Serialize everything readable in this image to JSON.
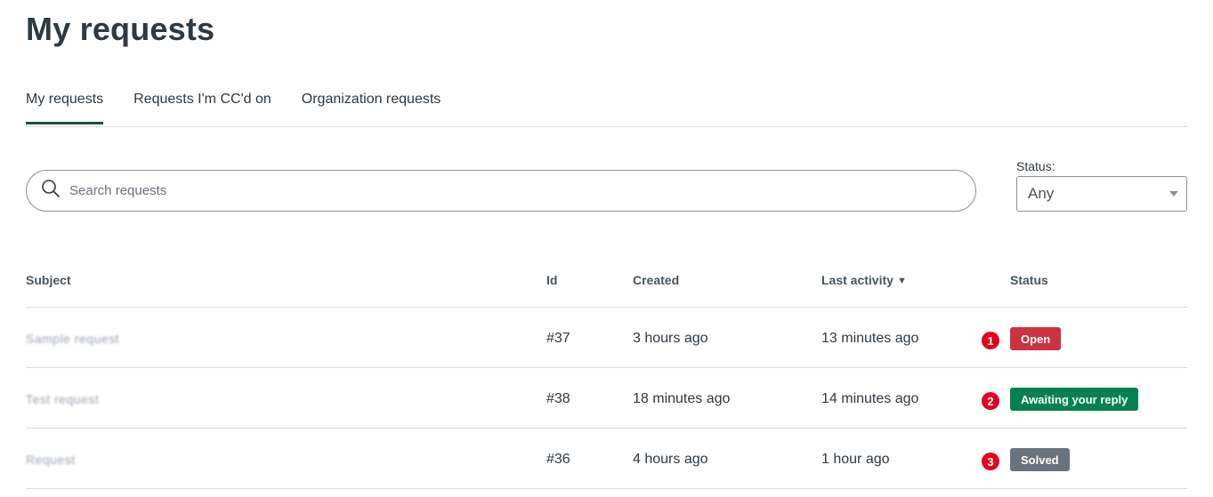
{
  "page": {
    "title": "My requests"
  },
  "tabs": [
    {
      "label": "My requests",
      "active": true
    },
    {
      "label": "Requests I'm CC'd on",
      "active": false
    },
    {
      "label": "Organization requests",
      "active": false
    }
  ],
  "search": {
    "placeholder": "Search requests",
    "value": ""
  },
  "status_filter": {
    "label": "Status:",
    "selected": "Any"
  },
  "table": {
    "headers": {
      "subject": "Subject",
      "id": "Id",
      "created": "Created",
      "last_activity": "Last activity",
      "sort_indicator": "▼",
      "status": "Status"
    },
    "rows": [
      {
        "subject": "Sample request",
        "id": "#37",
        "created": "3 hours ago",
        "last_activity": "13 minutes ago",
        "marker": "1",
        "status": "Open",
        "status_color": "#cc3340"
      },
      {
        "subject": "Test request",
        "id": "#38",
        "created": "18 minutes ago",
        "last_activity": "14 minutes ago",
        "marker": "2",
        "status": "Awaiting your reply",
        "status_color": "#038153"
      },
      {
        "subject": "Request",
        "id": "#36",
        "created": "4 hours ago",
        "last_activity": "1 hour ago",
        "marker": "3",
        "status": "Solved",
        "status_color": "#68737d"
      }
    ]
  },
  "colors": {
    "tab_active": "#1f4e46",
    "marker": "#e3001b"
  }
}
